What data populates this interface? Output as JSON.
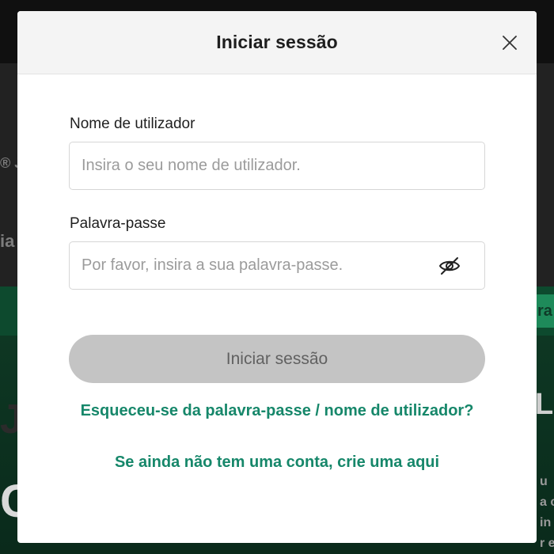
{
  "background": {
    "snippets": {
      "a": "® J",
      "b": "ia",
      "c": "ra",
      "d": "LS",
      "e": "J",
      "f": "C",
      "g": "u\na c\nin\nr e"
    }
  },
  "modal": {
    "title": "Iniciar sessão",
    "close_icon": "close-icon",
    "username": {
      "label": "Nome de utilizador",
      "placeholder": "Insira o seu nome de utilizador.",
      "value": ""
    },
    "password": {
      "label": "Palavra-passe",
      "placeholder": "Por favor, insira a sua palavra-passe.",
      "value": "",
      "toggle_icon": "eye-off-icon"
    },
    "submit_label": "Iniciar sessão",
    "forgot_link": "Esqueceu-se da palavra-passe / nome de utilizador?",
    "signup_link": "Se ainda não tem uma conta, crie uma aqui"
  },
  "colors": {
    "link": "#16876a",
    "button_disabled_bg": "#c4c4c4",
    "button_disabled_text": "#616161",
    "header_bg": "#f4f4f4"
  }
}
